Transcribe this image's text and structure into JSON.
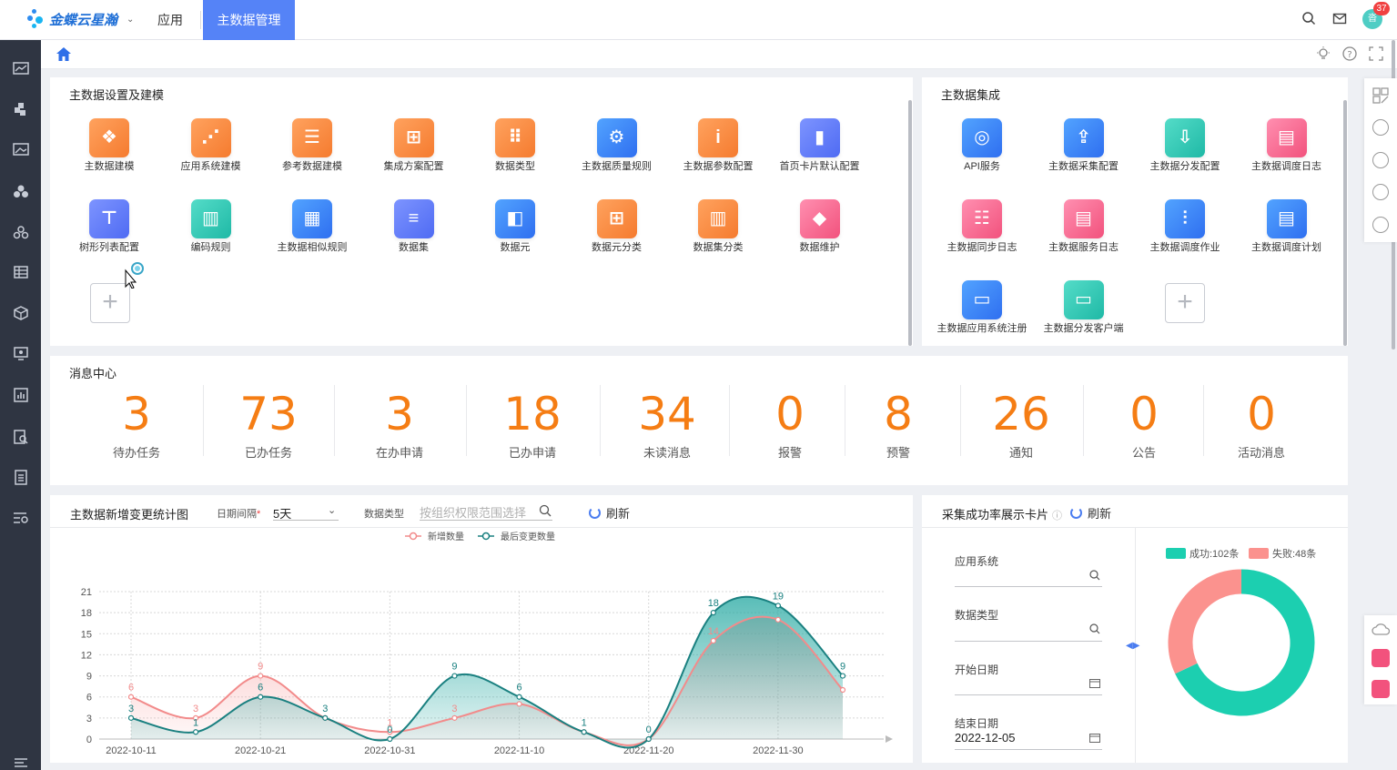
{
  "brand": {
    "name": "金蝶云星瀚"
  },
  "topnav": {
    "apps": "应用",
    "active": "主数据管理",
    "badge_count": "37",
    "avatar_text": "沓"
  },
  "setup": {
    "title": "主数据设置及建模",
    "tiles": [
      {
        "label": "主数据建模",
        "icon": "cubes-icon",
        "color": "orange"
      },
      {
        "label": "应用系统建模",
        "icon": "network-icon",
        "color": "orange"
      },
      {
        "label": "参考数据建模",
        "icon": "document-icon",
        "color": "orange"
      },
      {
        "label": "集成方案配置",
        "icon": "hierarchy-icon",
        "color": "orange"
      },
      {
        "label": "数据类型",
        "icon": "dots-grid-icon",
        "color": "orange"
      },
      {
        "label": "主数据质量规则",
        "icon": "gear-icon",
        "color": "blue"
      },
      {
        "label": "主数据参数配置",
        "icon": "book-icon",
        "color": "orange"
      },
      {
        "label": "首页卡片默认配置",
        "icon": "card-icon",
        "color": "purple"
      },
      {
        "label": "树形列表配置",
        "icon": "tree-icon",
        "color": "purple"
      },
      {
        "label": "编码规则",
        "icon": "barcode-icon",
        "color": "teal"
      },
      {
        "label": "主数据相似规则",
        "icon": "table-icon",
        "color": "blue"
      },
      {
        "label": "数据集",
        "icon": "list-icon",
        "color": "purple"
      },
      {
        "label": "数据元",
        "icon": "ruler-icon",
        "color": "blue"
      },
      {
        "label": "数据元分类",
        "icon": "hierarchy-icon",
        "color": "orange"
      },
      {
        "label": "数据集分类",
        "icon": "books-icon",
        "color": "orange"
      },
      {
        "label": "数据维护",
        "icon": "shapes-icon",
        "color": "pink"
      }
    ]
  },
  "integration": {
    "title": "主数据集成",
    "tiles": [
      {
        "label": "API服务",
        "icon": "api-icon",
        "color": "blue"
      },
      {
        "label": "主数据采集配置",
        "icon": "upload-icon",
        "color": "blue"
      },
      {
        "label": "主数据分发配置",
        "icon": "download-icon",
        "color": "teal"
      },
      {
        "label": "主数据调度日志",
        "icon": "log-icon",
        "color": "pink"
      },
      {
        "label": "主数据同步日志",
        "icon": "server-icon",
        "color": "pink"
      },
      {
        "label": "主数据服务日志",
        "icon": "clipboard-icon",
        "color": "pink"
      },
      {
        "label": "主数据调度作业",
        "icon": "sliders-icon",
        "color": "blue"
      },
      {
        "label": "主数据调度计划",
        "icon": "planner-icon",
        "color": "blue"
      },
      {
        "label": "主数据应用系统注册",
        "icon": "monitor-icon",
        "color": "blue"
      },
      {
        "label": "主数据分发客户端",
        "icon": "desktop-icon",
        "color": "teal"
      }
    ]
  },
  "messages": {
    "title": "消息中心",
    "items": [
      {
        "count": "3",
        "label": "待办任务"
      },
      {
        "count": "73",
        "label": "已办任务"
      },
      {
        "count": "3",
        "label": "在办申请"
      },
      {
        "count": "18",
        "label": "已办申请"
      },
      {
        "count": "34",
        "label": "未读消息"
      },
      {
        "count": "0",
        "label": "报警"
      },
      {
        "count": "8",
        "label": "预警"
      },
      {
        "count": "26",
        "label": "通知"
      },
      {
        "count": "0",
        "label": "公告"
      },
      {
        "count": "0",
        "label": "活动消息"
      }
    ]
  },
  "trend": {
    "title": "主数据新增变更统计图",
    "interval_label": "日期间隔",
    "interval_value": "5天",
    "datatype_label": "数据类型",
    "datatype_placeholder": "按组织权限范围选择",
    "refresh": "刷新"
  },
  "success": {
    "title": "采集成功率展示卡片",
    "refresh": "刷新",
    "app_label": "应用系统",
    "type_label": "数据类型",
    "start_label": "开始日期",
    "end_label": "结束日期",
    "end_value": "2022-12-05"
  },
  "chart_data": [
    {
      "type": "area",
      "x": [
        "2022-10-11",
        "2022-10-16",
        "2022-10-21",
        "2022-10-26",
        "2022-10-31",
        "2022-11-05",
        "2022-11-10",
        "2022-11-15",
        "2022-11-20",
        "2022-11-25",
        "2022-11-30",
        "2022-12-05"
      ],
      "x_tick_labels": [
        "2022-10-11",
        "2022-10-21",
        "2022-10-31",
        "2022-11-10",
        "2022-11-20",
        "2022-11-30"
      ],
      "series": [
        {
          "name": "新增数量",
          "color": "#f28b8b",
          "values": [
            6,
            3,
            9,
            3,
            1,
            3,
            5,
            1,
            0,
            14,
            17,
            7
          ]
        },
        {
          "name": "最后变更数量",
          "color": "#1a8080",
          "values": [
            3,
            1,
            6,
            3,
            0,
            9,
            6,
            1,
            0,
            18,
            19,
            9
          ]
        }
      ],
      "data_labels_new": [
        "6",
        "3",
        "9",
        "",
        "1",
        "3",
        "",
        "",
        "",
        "14",
        "",
        ""
      ],
      "data_labels_change": [
        "3",
        "1",
        "6",
        "3",
        "0",
        "9",
        "6",
        "1",
        "0",
        "18",
        "19",
        "9"
      ],
      "yticks": [
        0,
        3,
        6,
        9,
        12,
        15,
        18,
        21
      ],
      "ylim": [
        0,
        21
      ],
      "grid": true,
      "legend": "top-center"
    },
    {
      "type": "pie",
      "labels": [
        "成功:102条",
        "失败:48条"
      ],
      "values": [
        102,
        48
      ],
      "colors": [
        "#1ccfb0",
        "#fb928e"
      ],
      "legend": "top-center"
    }
  ]
}
